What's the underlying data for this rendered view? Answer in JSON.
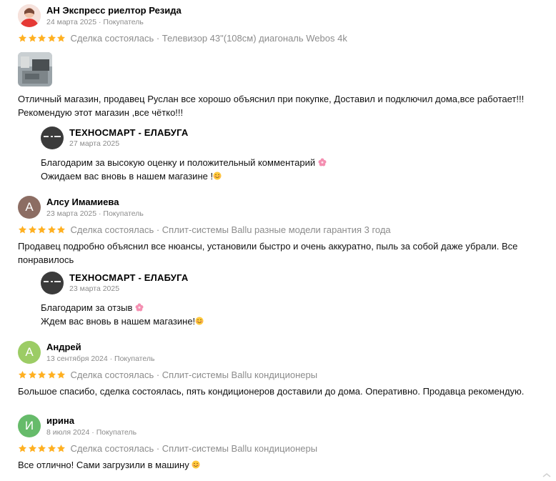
{
  "reviews": [
    {
      "author": "АН Экспресс риелтор Резида",
      "date": "24 марта 2025",
      "role": "Покупатель",
      "deal": "Сделка состоялась",
      "product": "Телевизор 43\"(108см) диагональ Webos 4k",
      "rating": 5,
      "line1": "Отличный магазин, продавец Руслан все хорошо объяснил при покупке, Доставил и подключил дома,все работает!!!",
      "line2": "Рекомендую этот магазин ,все чётко!!!",
      "reply": {
        "shop": "ТЕХНОСМАРТ - ЕЛАБУГА",
        "date": "27 марта 2025",
        "line1": "Благодарим за высокую оценку и положительный комментарий",
        "line2": "Ожидаем вас вновь в нашем магазине !"
      }
    },
    {
      "author": "Алсу Имамиева",
      "initial": "А",
      "avatar_color": "#8c6d63",
      "date": "23 марта 2025",
      "role": "Покупатель",
      "deal": "Сделка состоялась",
      "product": "Сплит-системы Ballu разные модели гарантия 3 года",
      "rating": 5,
      "line1": "Продавец подробно объяснил все нюансы, установили быстро и очень аккуратно, пыль за собой даже убрали. Все",
      "line2": "понравилось",
      "reply": {
        "shop": "ТЕХНОСМАРТ - ЕЛАБУГА",
        "date": "23 марта 2025",
        "line1": "Благодарим за отзыв",
        "line2": "Ждем вас вновь в нашем магазине!"
      }
    },
    {
      "author": "Андрей",
      "initial": "А",
      "avatar_color": "#9ccc65",
      "date": "13 сентября 2024",
      "role": "Покупатель",
      "deal": "Сделка состоялась",
      "product": "Сплит-системы Ballu кондиционеры",
      "rating": 5,
      "line1": "Большое спасибо, сделка состоялась, пять кондиционеров доставили до дома. Оперативно. Продавца рекомендую."
    },
    {
      "author": "ирина",
      "initial": "И",
      "avatar_color": "#66bb6a",
      "date": "8 июля 2024",
      "role": "Покупатель",
      "deal": "Сделка состоялась",
      "product": "Сплит-системы Ballu кондиционеры",
      "rating": 5,
      "line1": "Все отлично! Сами загрузили в машину"
    }
  ],
  "colors": {
    "star": "#ffb021",
    "meta_gray": "#8c8c8c"
  }
}
